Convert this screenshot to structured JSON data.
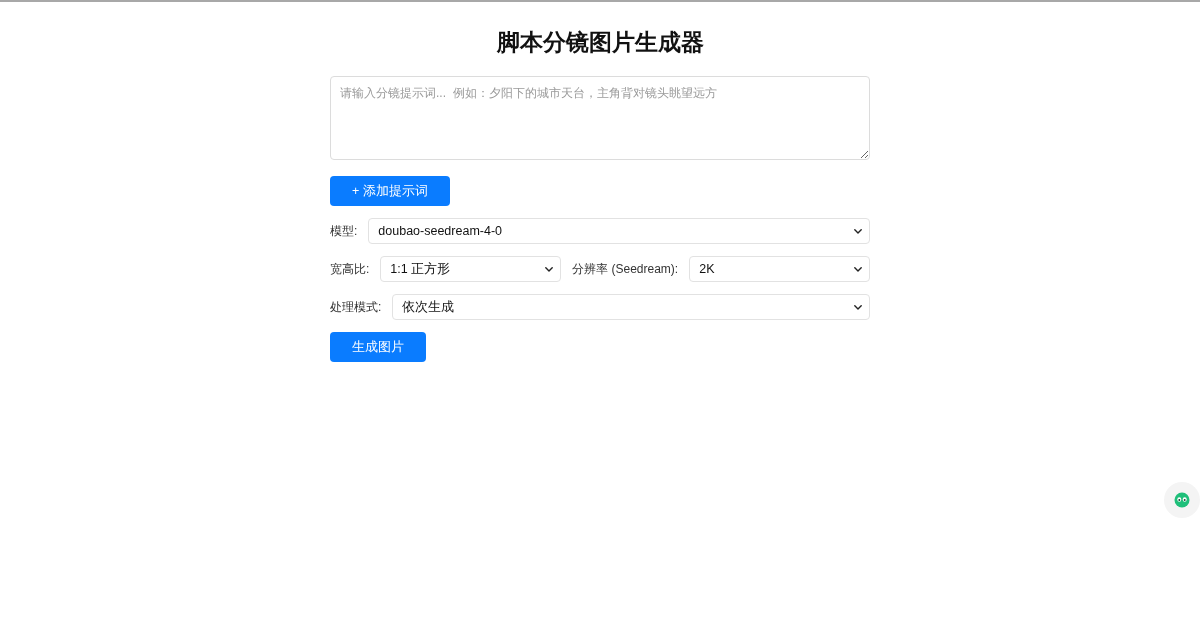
{
  "title": "脚本分镜图片生成器",
  "prompt_field": {
    "placeholder": "请输入分镜提示词...  例如：夕阳下的城市天台，主角背对镜头眺望远方"
  },
  "add_button": {
    "label": "+ 添加提示词"
  },
  "settings": [
    {
      "fields": [
        {
          "label": "模型:",
          "value": "doubao-seedream-4-0"
        }
      ]
    },
    {
      "fields": [
        {
          "label": "宽高比:",
          "value": "1:1 正方形"
        },
        {
          "label": "分辨率 (Seedream):",
          "value": "2K"
        }
      ]
    },
    {
      "fields": [
        {
          "label": "处理模式:",
          "value": "依次生成"
        }
      ]
    }
  ],
  "generate_button": {
    "label": "生成图片"
  }
}
